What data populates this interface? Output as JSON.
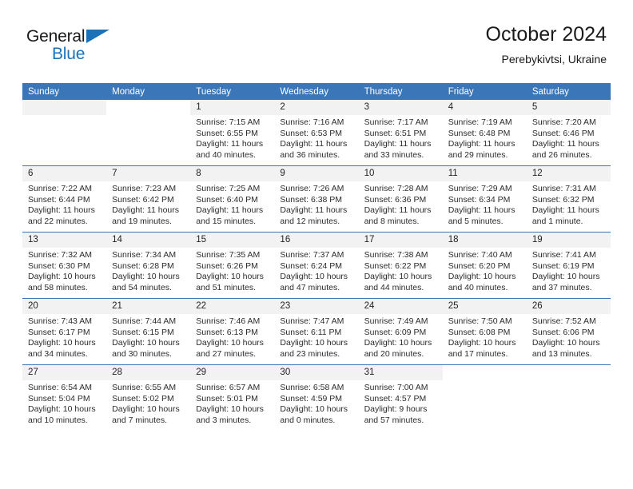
{
  "brand": {
    "name_top": "General",
    "name_bottom": "Blue",
    "triangle_color": "#1b72b8",
    "icon": "triangle-logo-icon"
  },
  "header": {
    "title": "October 2024",
    "subtitle": "Perebykivtsi, Ukraine"
  },
  "theme": {
    "header_blue": "#3a76b8",
    "daystrip_grey": "#f2f2f2",
    "brand_blue": "#1b72b8",
    "text": "#222222"
  },
  "weekdays": [
    "Sunday",
    "Monday",
    "Tuesday",
    "Wednesday",
    "Thursday",
    "Friday",
    "Saturday"
  ],
  "labels": {
    "sunrise_prefix": "Sunrise:",
    "sunset_prefix": "Sunset:",
    "daylight_prefix": "Daylight:"
  },
  "weeks": [
    [
      {
        "day": "",
        "blank": true,
        "greystrip": true
      },
      {
        "day": "",
        "blank": true,
        "greystrip": false
      },
      {
        "day": "1",
        "sunrise": "Sunrise: 7:15 AM",
        "sunset": "Sunset: 6:55 PM",
        "daylight": "Daylight: 11 hours and 40 minutes."
      },
      {
        "day": "2",
        "sunrise": "Sunrise: 7:16 AM",
        "sunset": "Sunset: 6:53 PM",
        "daylight": "Daylight: 11 hours and 36 minutes."
      },
      {
        "day": "3",
        "sunrise": "Sunrise: 7:17 AM",
        "sunset": "Sunset: 6:51 PM",
        "daylight": "Daylight: 11 hours and 33 minutes."
      },
      {
        "day": "4",
        "sunrise": "Sunrise: 7:19 AM",
        "sunset": "Sunset: 6:48 PM",
        "daylight": "Daylight: 11 hours and 29 minutes."
      },
      {
        "day": "5",
        "sunrise": "Sunrise: 7:20 AM",
        "sunset": "Sunset: 6:46 PM",
        "daylight": "Daylight: 11 hours and 26 minutes."
      }
    ],
    [
      {
        "day": "6",
        "sunrise": "Sunrise: 7:22 AM",
        "sunset": "Sunset: 6:44 PM",
        "daylight": "Daylight: 11 hours and 22 minutes."
      },
      {
        "day": "7",
        "sunrise": "Sunrise: 7:23 AM",
        "sunset": "Sunset: 6:42 PM",
        "daylight": "Daylight: 11 hours and 19 minutes."
      },
      {
        "day": "8",
        "sunrise": "Sunrise: 7:25 AM",
        "sunset": "Sunset: 6:40 PM",
        "daylight": "Daylight: 11 hours and 15 minutes."
      },
      {
        "day": "9",
        "sunrise": "Sunrise: 7:26 AM",
        "sunset": "Sunset: 6:38 PM",
        "daylight": "Daylight: 11 hours and 12 minutes."
      },
      {
        "day": "10",
        "sunrise": "Sunrise: 7:28 AM",
        "sunset": "Sunset: 6:36 PM",
        "daylight": "Daylight: 11 hours and 8 minutes."
      },
      {
        "day": "11",
        "sunrise": "Sunrise: 7:29 AM",
        "sunset": "Sunset: 6:34 PM",
        "daylight": "Daylight: 11 hours and 5 minutes."
      },
      {
        "day": "12",
        "sunrise": "Sunrise: 7:31 AM",
        "sunset": "Sunset: 6:32 PM",
        "daylight": "Daylight: 11 hours and 1 minute."
      }
    ],
    [
      {
        "day": "13",
        "sunrise": "Sunrise: 7:32 AM",
        "sunset": "Sunset: 6:30 PM",
        "daylight": "Daylight: 10 hours and 58 minutes."
      },
      {
        "day": "14",
        "sunrise": "Sunrise: 7:34 AM",
        "sunset": "Sunset: 6:28 PM",
        "daylight": "Daylight: 10 hours and 54 minutes."
      },
      {
        "day": "15",
        "sunrise": "Sunrise: 7:35 AM",
        "sunset": "Sunset: 6:26 PM",
        "daylight": "Daylight: 10 hours and 51 minutes."
      },
      {
        "day": "16",
        "sunrise": "Sunrise: 7:37 AM",
        "sunset": "Sunset: 6:24 PM",
        "daylight": "Daylight: 10 hours and 47 minutes."
      },
      {
        "day": "17",
        "sunrise": "Sunrise: 7:38 AM",
        "sunset": "Sunset: 6:22 PM",
        "daylight": "Daylight: 10 hours and 44 minutes."
      },
      {
        "day": "18",
        "sunrise": "Sunrise: 7:40 AM",
        "sunset": "Sunset: 6:20 PM",
        "daylight": "Daylight: 10 hours and 40 minutes."
      },
      {
        "day": "19",
        "sunrise": "Sunrise: 7:41 AM",
        "sunset": "Sunset: 6:19 PM",
        "daylight": "Daylight: 10 hours and 37 minutes."
      }
    ],
    [
      {
        "day": "20",
        "sunrise": "Sunrise: 7:43 AM",
        "sunset": "Sunset: 6:17 PM",
        "daylight": "Daylight: 10 hours and 34 minutes."
      },
      {
        "day": "21",
        "sunrise": "Sunrise: 7:44 AM",
        "sunset": "Sunset: 6:15 PM",
        "daylight": "Daylight: 10 hours and 30 minutes."
      },
      {
        "day": "22",
        "sunrise": "Sunrise: 7:46 AM",
        "sunset": "Sunset: 6:13 PM",
        "daylight": "Daylight: 10 hours and 27 minutes."
      },
      {
        "day": "23",
        "sunrise": "Sunrise: 7:47 AM",
        "sunset": "Sunset: 6:11 PM",
        "daylight": "Daylight: 10 hours and 23 minutes."
      },
      {
        "day": "24",
        "sunrise": "Sunrise: 7:49 AM",
        "sunset": "Sunset: 6:09 PM",
        "daylight": "Daylight: 10 hours and 20 minutes."
      },
      {
        "day": "25",
        "sunrise": "Sunrise: 7:50 AM",
        "sunset": "Sunset: 6:08 PM",
        "daylight": "Daylight: 10 hours and 17 minutes."
      },
      {
        "day": "26",
        "sunrise": "Sunrise: 7:52 AM",
        "sunset": "Sunset: 6:06 PM",
        "daylight": "Daylight: 10 hours and 13 minutes."
      }
    ],
    [
      {
        "day": "27",
        "sunrise": "Sunrise: 6:54 AM",
        "sunset": "Sunset: 5:04 PM",
        "daylight": "Daylight: 10 hours and 10 minutes."
      },
      {
        "day": "28",
        "sunrise": "Sunrise: 6:55 AM",
        "sunset": "Sunset: 5:02 PM",
        "daylight": "Daylight: 10 hours and 7 minutes."
      },
      {
        "day": "29",
        "sunrise": "Sunrise: 6:57 AM",
        "sunset": "Sunset: 5:01 PM",
        "daylight": "Daylight: 10 hours and 3 minutes."
      },
      {
        "day": "30",
        "sunrise": "Sunrise: 6:58 AM",
        "sunset": "Sunset: 4:59 PM",
        "daylight": "Daylight: 10 hours and 0 minutes."
      },
      {
        "day": "31",
        "sunrise": "Sunrise: 7:00 AM",
        "sunset": "Sunset: 4:57 PM",
        "daylight": "Daylight: 9 hours and 57 minutes."
      },
      {
        "day": "",
        "blank": true,
        "greystrip": false
      },
      {
        "day": "",
        "blank": true,
        "greystrip": false
      }
    ]
  ]
}
